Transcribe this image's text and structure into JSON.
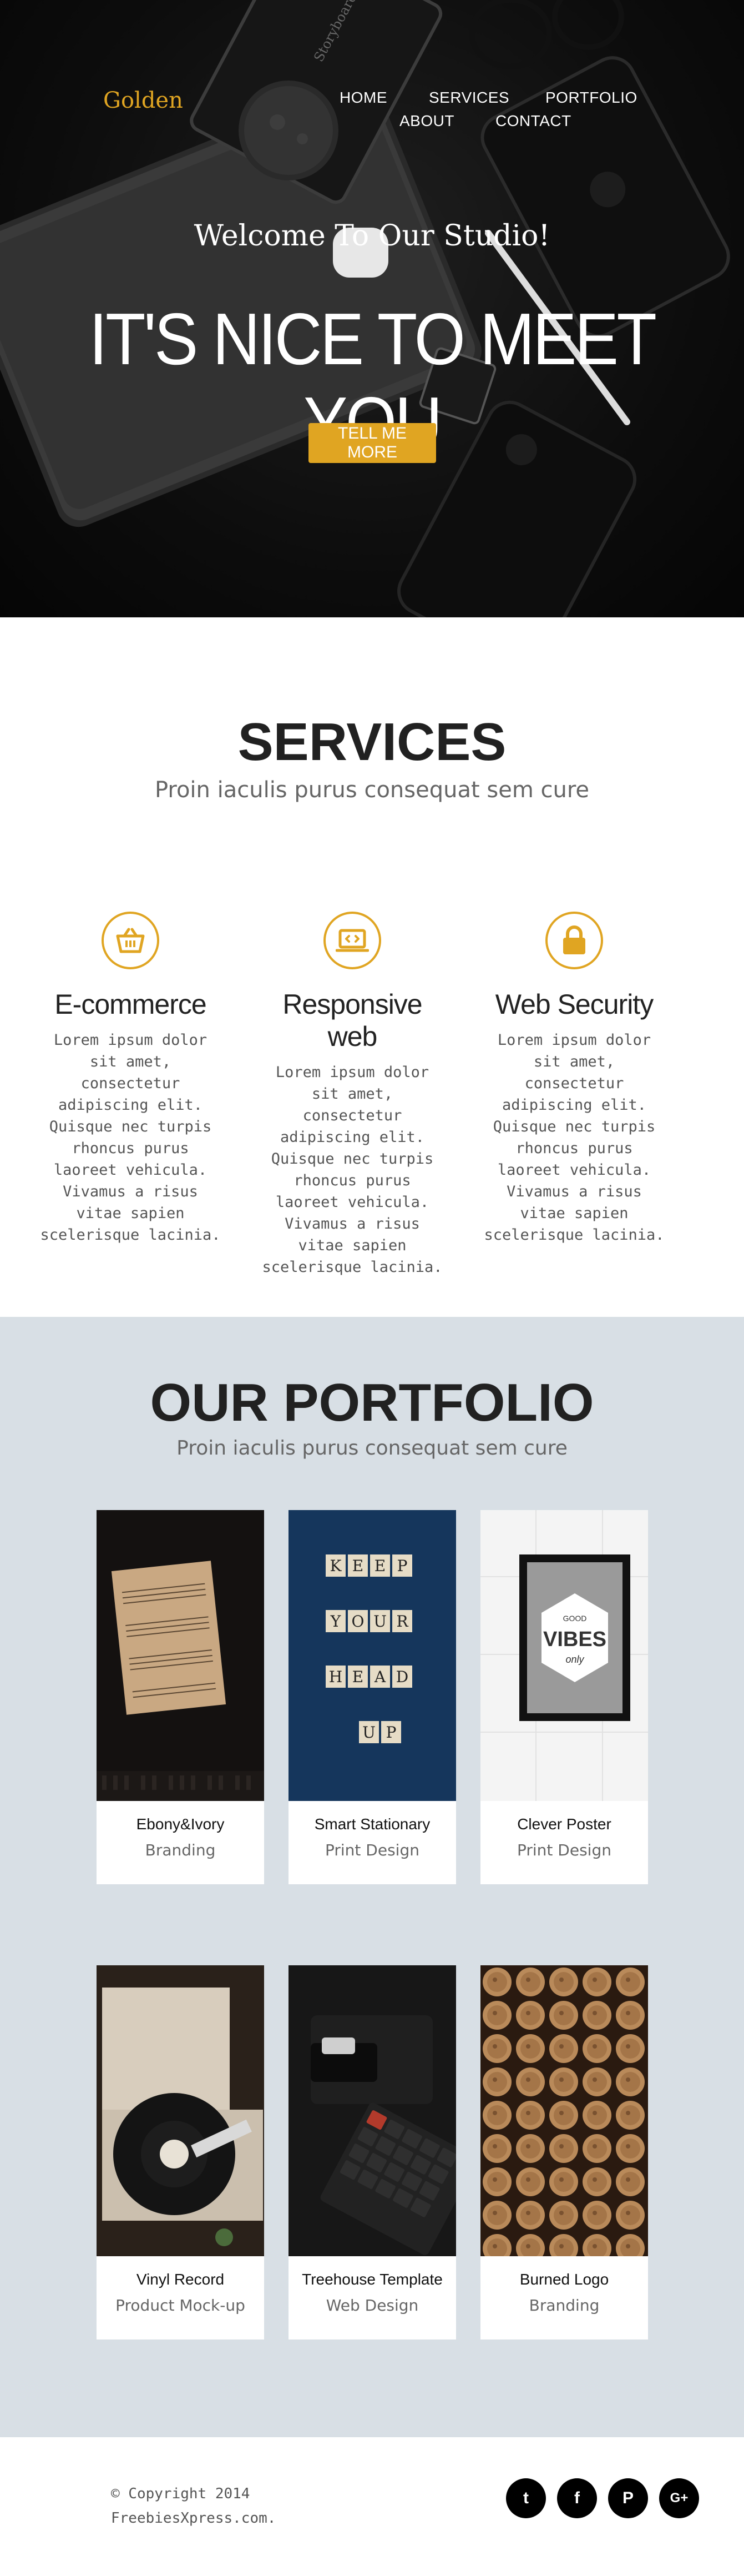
{
  "brand": {
    "logo": "Golden",
    "accent": "#e0a522"
  },
  "nav": {
    "home": "HOME",
    "services": "SERVICES",
    "portfolio": "PORTFOLIO",
    "about": "ABOUT",
    "contact": "CONTACT"
  },
  "hero": {
    "welcome": "Welcome To Our Studio!",
    "title": "IT'S NICE TO MEET YOU",
    "button": "TELL ME MORE",
    "notebook_text": "Storyboard"
  },
  "services": {
    "title": "SERVICES",
    "subtitle": "Proin iaculis purus consequat sem cure",
    "items": [
      {
        "icon": "basket-icon",
        "title": "E-commerce",
        "text": "Lorem ipsum dolor sit amet, consectetur adipiscing elit. Quisque nec turpis rhoncus purus laoreet vehicula. Vivamus a risus vitae sapien scelerisque lacinia."
      },
      {
        "icon": "laptop-code-icon",
        "title": "Responsive web",
        "text": "Lorem ipsum dolor sit amet, consectetur adipiscing elit. Quisque nec turpis rhoncus purus laoreet vehicula. Vivamus a risus vitae sapien scelerisque lacinia."
      },
      {
        "icon": "lock-icon",
        "title": "Web Security",
        "text": "Lorem ipsum dolor sit amet, consectetur adipiscing elit. Quisque nec turpis rhoncus purus laoreet vehicula. Vivamus a risus vitae sapien scelerisque lacinia."
      }
    ]
  },
  "portfolio": {
    "title": "OUR PORTFOLIO",
    "subtitle": "Proin iaculis purus consequat sem cure",
    "items": [
      {
        "title": "Ebony&Ivory",
        "category": "Branding"
      },
      {
        "title": "Smart Stationary",
        "category": "Print Design"
      },
      {
        "title": "Clever Poster",
        "category": "Print Design"
      },
      {
        "title": "Vinyl Record",
        "category": "Product Mock-up"
      },
      {
        "title": "Treehouse Template",
        "category": "Web Design"
      },
      {
        "title": "Burned Logo",
        "category": "Branding"
      }
    ],
    "scrabble": [
      "K",
      "E",
      "E",
      "P",
      "Y",
      "O",
      "U",
      "R",
      "H",
      "E",
      "A",
      "D",
      "U",
      "P"
    ],
    "poster_lines": [
      "GOOD",
      "VIBES",
      "only"
    ]
  },
  "footer": {
    "copyright_line1": "© Copyright 2014",
    "copyright_line2": "FreebiesXpress.com.",
    "social": [
      {
        "icon": "twitter-icon",
        "glyph": "t"
      },
      {
        "icon": "facebook-icon",
        "glyph": "f"
      },
      {
        "icon": "pinterest-icon",
        "glyph": "P"
      },
      {
        "icon": "google-plus-icon",
        "glyph": "G+"
      }
    ]
  }
}
